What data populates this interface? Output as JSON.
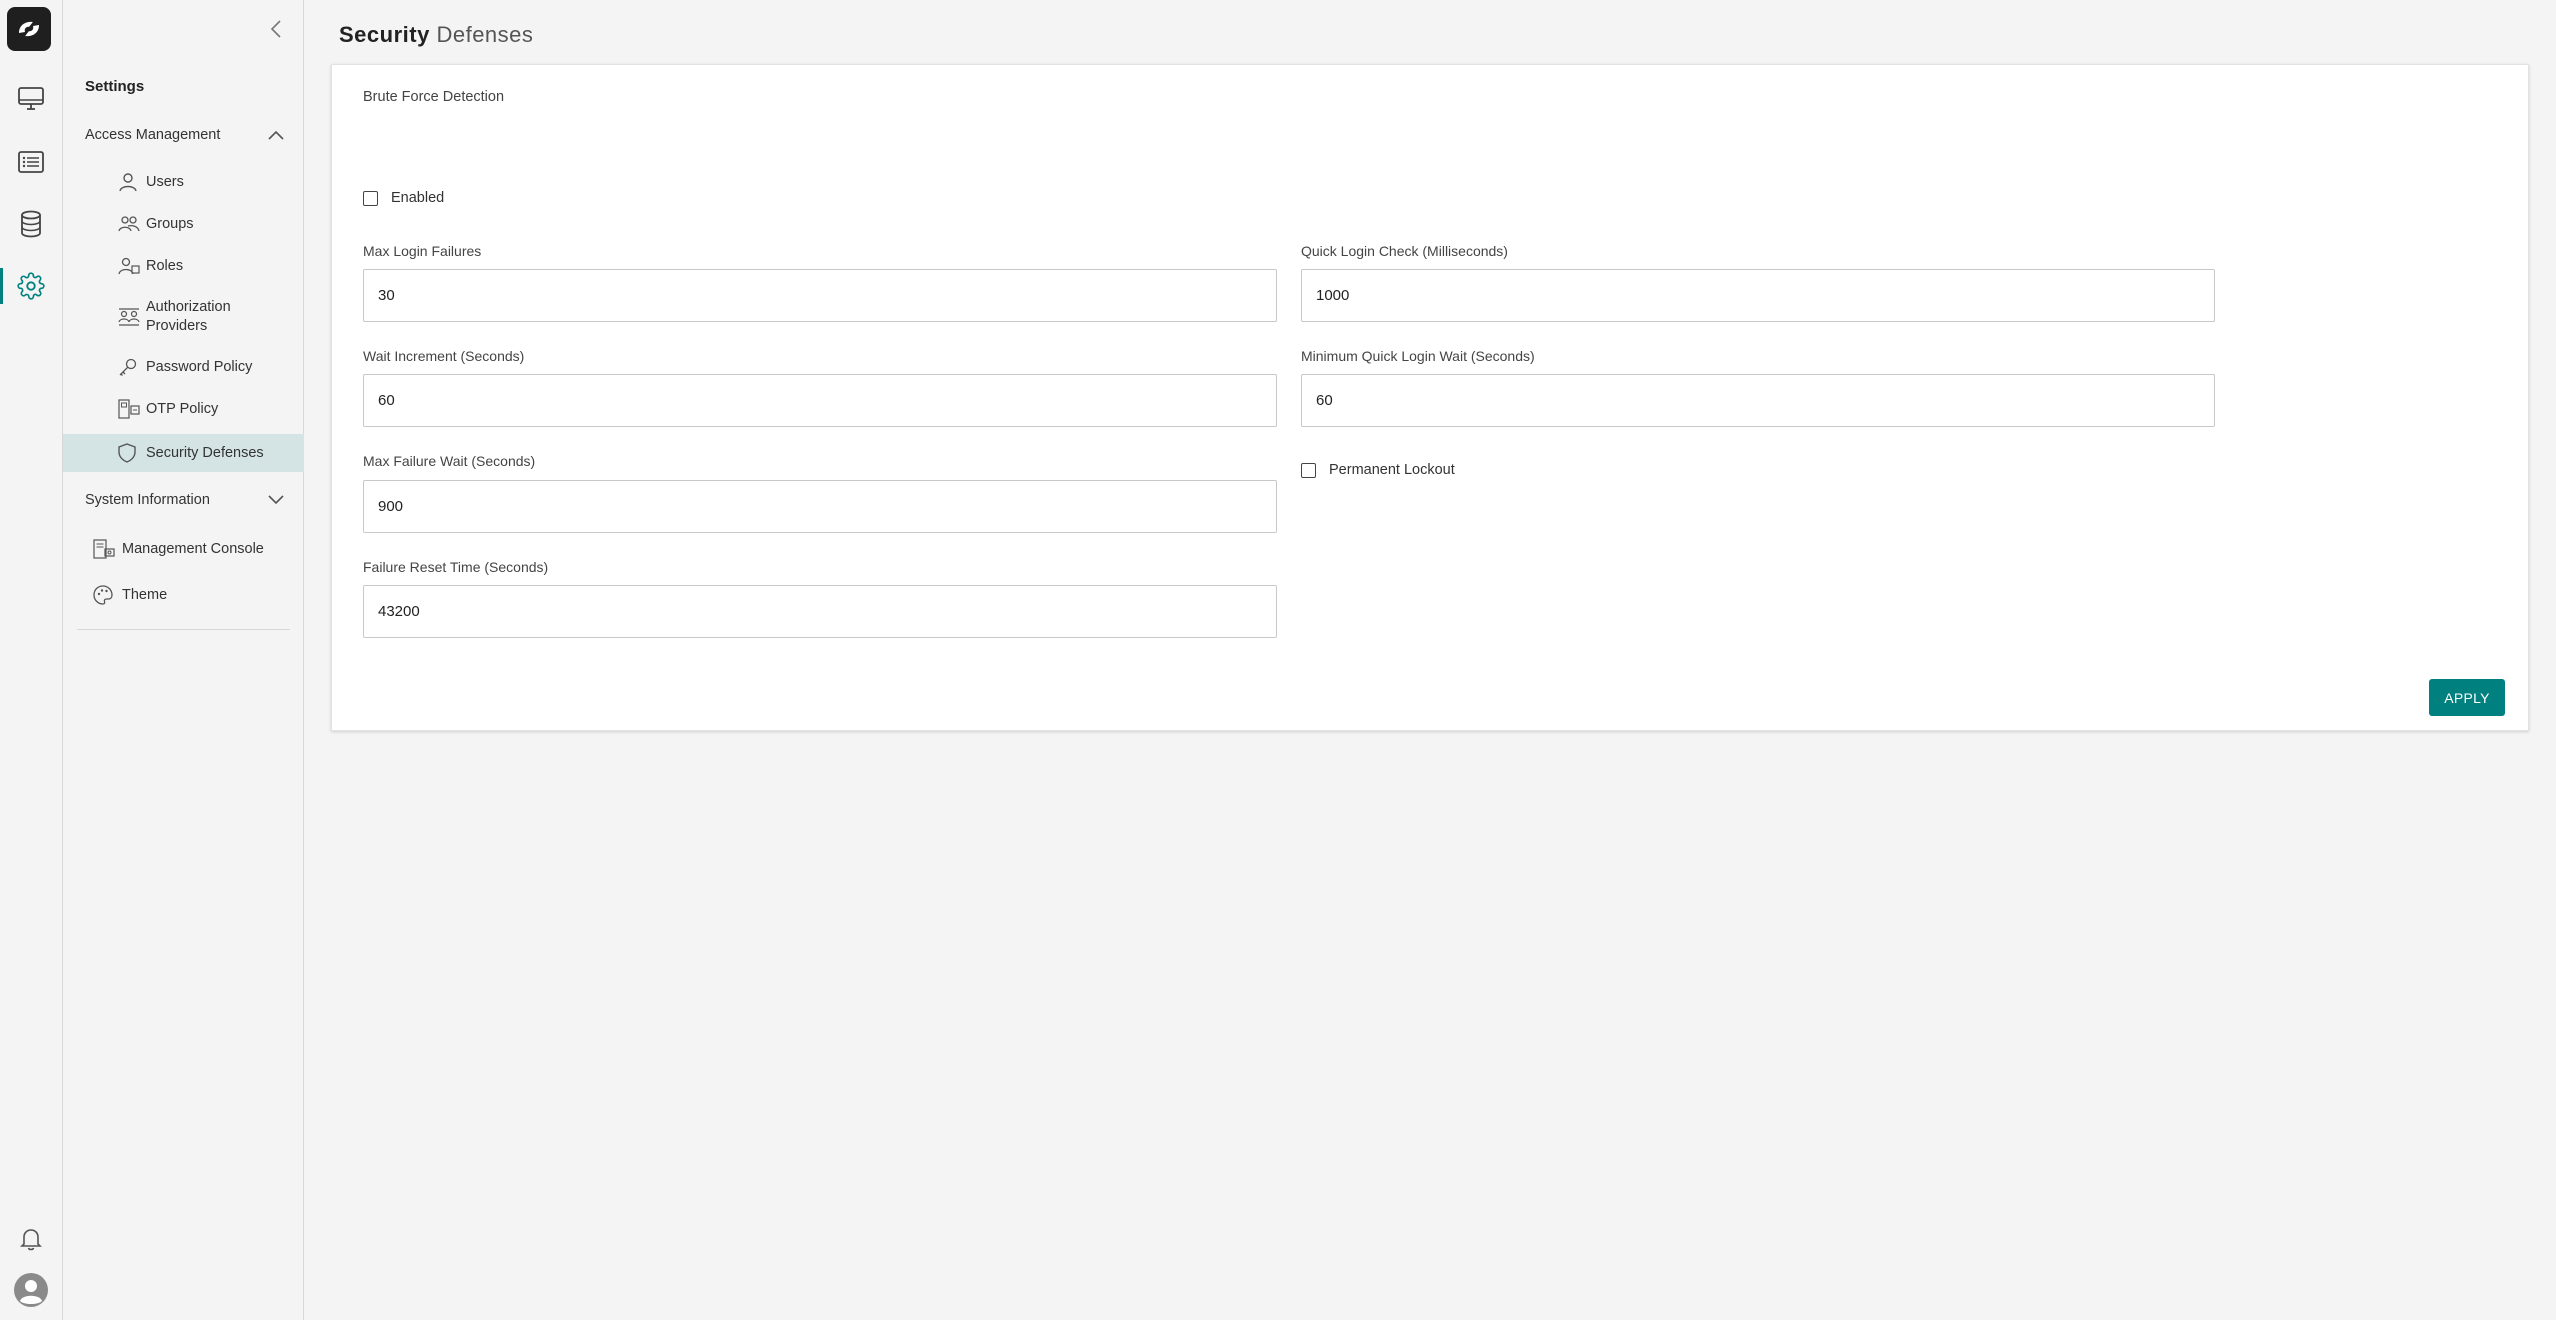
{
  "rail": {
    "logo_icon": "brand-logo-icon",
    "items": [
      "monitor-icon",
      "list-icon",
      "database-icon",
      "gear-icon"
    ],
    "bottom": [
      "bell-icon",
      "user-avatar-icon"
    ],
    "accent": "#00807f"
  },
  "sidebar": {
    "title": "Settings",
    "access_management": {
      "label": "Access Management",
      "items": [
        {
          "label": "Users",
          "icon": "user-icon"
        },
        {
          "label": "Groups",
          "icon": "groups-icon"
        },
        {
          "label": "Roles",
          "icon": "roles-icon"
        },
        {
          "label": "Authorization Providers",
          "icon": "authorization-providers-icon"
        },
        {
          "label": "Password Policy",
          "icon": "key-icon"
        },
        {
          "label": "OTP Policy",
          "icon": "otp-icon"
        },
        {
          "label": "Security Defenses",
          "icon": "shield-icon",
          "active": true
        }
      ]
    },
    "system_information": {
      "label": "System Information",
      "items": [
        {
          "label": "Management Console",
          "icon": "console-icon"
        },
        {
          "label": "Theme",
          "icon": "palette-icon"
        }
      ]
    }
  },
  "page": {
    "title_bold": "Security",
    "title_rest": "Defenses"
  },
  "form": {
    "section": "Brute Force Detection",
    "enabled_label": "Enabled",
    "enabled": false,
    "max_login_failures": {
      "label": "Max Login Failures",
      "value": "30"
    },
    "quick_login_check": {
      "label": "Quick Login Check (Milliseconds)",
      "value": "1000"
    },
    "wait_increment": {
      "label": "Wait Increment (Seconds)",
      "value": "60"
    },
    "min_quick_login_wait": {
      "label": "Minimum Quick Login Wait (Seconds)",
      "value": "60"
    },
    "max_failure_wait": {
      "label": "Max Failure Wait (Seconds)",
      "value": "900"
    },
    "permanent_lockout_label": "Permanent Lockout",
    "permanent_lockout": false,
    "failure_reset_time": {
      "label": "Failure Reset Time (Seconds)",
      "value": "43200"
    },
    "apply_label": "APPLY"
  }
}
